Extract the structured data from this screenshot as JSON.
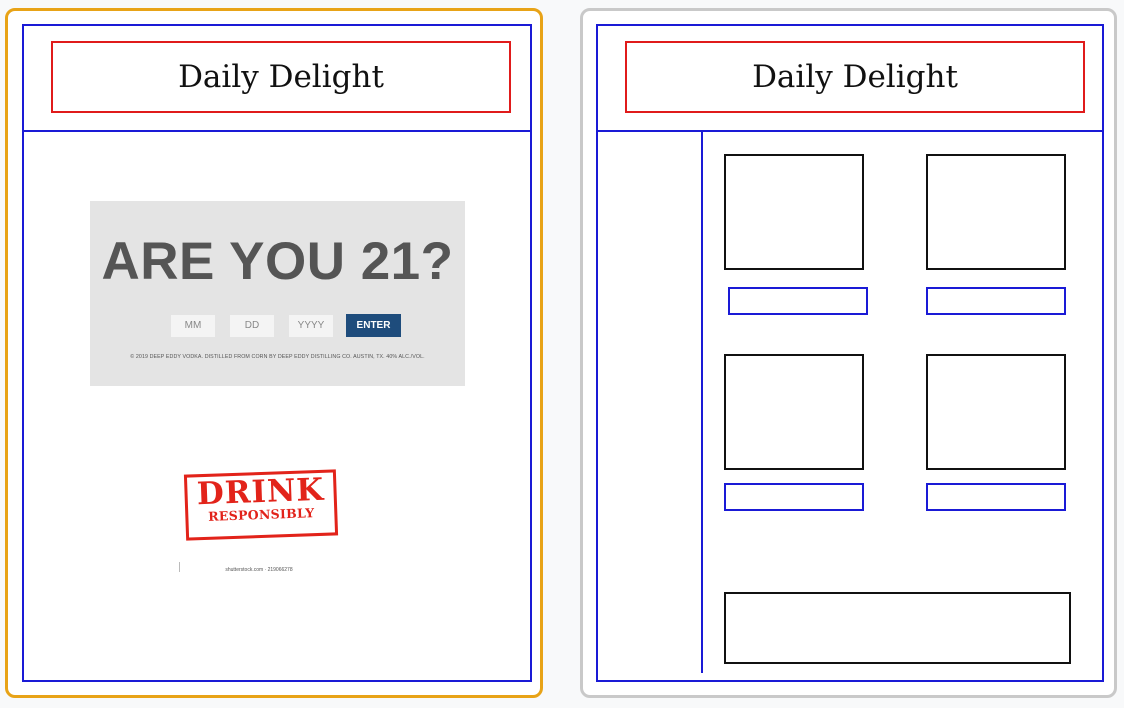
{
  "left_panel": {
    "site_title": "Daily Delight",
    "age_gate": {
      "heading": "ARE YOU 21?",
      "month_placeholder": "MM",
      "day_placeholder": "DD",
      "year_placeholder": "YYYY",
      "enter_label": "ENTER",
      "disclaimer": "© 2019 DEEP EDDY VODKA. DISTILLED FROM CORN BY DEEP EDDY DISTILLING CO. AUSTIN, TX. 40% ALC./VOL."
    },
    "stamp": {
      "line1": "DRINK",
      "line2": "RESPONSIBLY"
    },
    "stock_caption": "shutterstock.com · 219066278"
  },
  "right_panel": {
    "site_title": "Daily Delight"
  },
  "colors": {
    "selected_border": "#e8a317",
    "unselected_border": "#c9c9c9",
    "wireframe_blue": "#1a1ad6",
    "header_red": "#e01b1b",
    "enter_button": "#1e4c7c",
    "stamp_red": "#e2231a"
  }
}
